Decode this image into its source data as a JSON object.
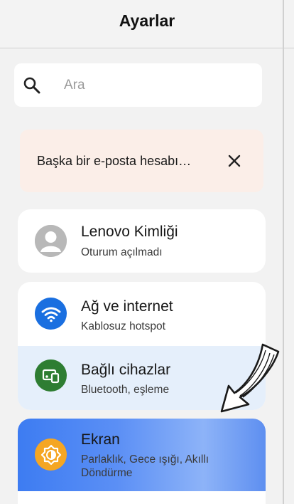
{
  "header": {
    "title": "Ayarlar"
  },
  "search": {
    "placeholder": "Ara",
    "icon": "search-icon"
  },
  "banner": {
    "text": "Başka bir e-posta hesabı…",
    "close_icon": "close-icon"
  },
  "account": {
    "title": "Lenovo Kimliği",
    "subtitle": "Oturum açılmadı",
    "icon": "avatar-icon"
  },
  "settings": [
    {
      "title": "Ağ ve internet",
      "subtitle": "Kablosuz hotspot",
      "icon": "wifi-icon",
      "color": "#1a6fe0"
    },
    {
      "title": "Bağlı cihazlar",
      "subtitle": "Bluetooth, eşleme",
      "icon": "connected-devices-icon",
      "color": "#2e7d32"
    },
    {
      "title": "Ekran",
      "subtitle_line1": "Parlaklık, Gece ışığı, Akıllı",
      "subtitle_line2": "Döndürme",
      "icon": "brightness-icon",
      "color": "#f5a623"
    }
  ]
}
